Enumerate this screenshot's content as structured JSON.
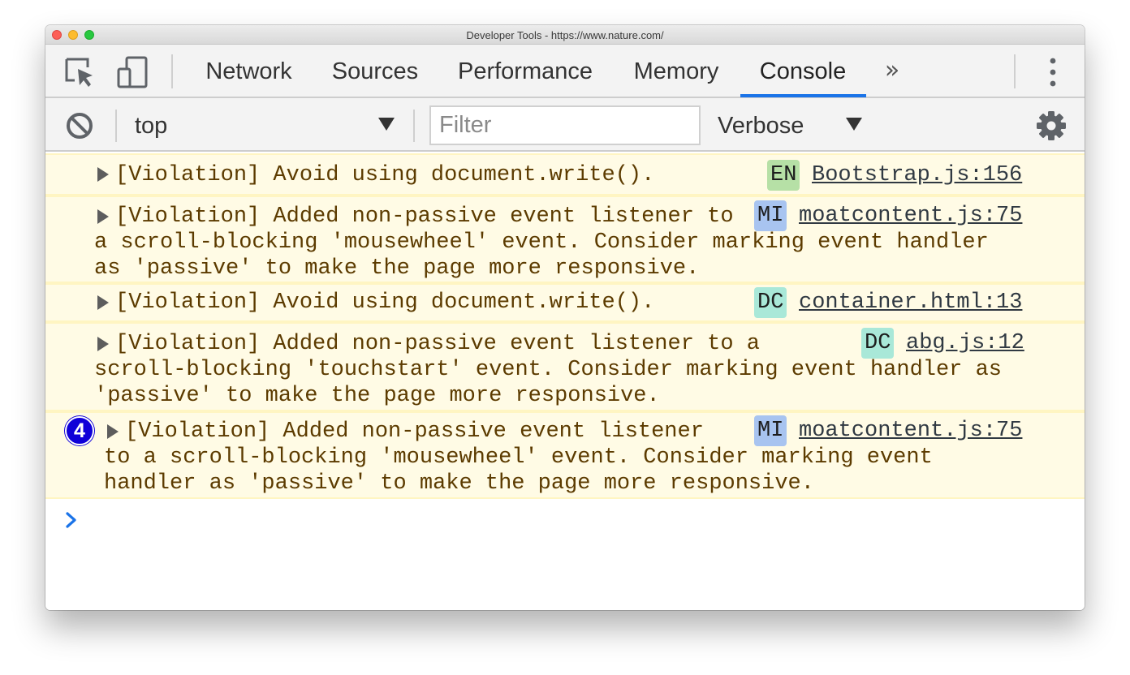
{
  "window": {
    "title": "Developer Tools - https://www.nature.com/"
  },
  "toolbar_icons": {
    "inspect": "inspect-element-icon",
    "device": "device-toolbar-icon",
    "more_tabs": "»",
    "menu": "kebab-menu-icon"
  },
  "tabs": [
    {
      "label": "Network",
      "active": false
    },
    {
      "label": "Sources",
      "active": false
    },
    {
      "label": "Performance",
      "active": false
    },
    {
      "label": "Memory",
      "active": false
    },
    {
      "label": "Console",
      "active": true
    }
  ],
  "console_toolbar": {
    "context": "top",
    "filter_placeholder": "Filter",
    "level": "Verbose",
    "accent_color": "#1a73e8"
  },
  "messages": [
    {
      "lines": [
        "[Violation] Avoid using document.write()."
      ],
      "badge": "EN",
      "badge_color": "#b6e0a6",
      "source": "Bootstrap.js:156",
      "repeat_count": null
    },
    {
      "lines": [
        "[Violation] Added non-passive event listener to",
        "a scroll-blocking 'mousewheel' event. Consider marking event handler",
        "as 'passive' to make the page more responsive."
      ],
      "badge": "MI",
      "badge_color": "#a8c4f0",
      "source": "moatcontent.js:75",
      "repeat_count": null
    },
    {
      "lines": [
        "[Violation] Avoid using document.write()."
      ],
      "badge": "DC",
      "badge_color": "#a9e8d8",
      "source": "container.html:13",
      "repeat_count": null
    },
    {
      "lines": [
        "[Violation] Added non-passive event listener to a",
        "scroll-blocking 'touchstart' event. Consider marking event handler as",
        "'passive' to make the page more responsive."
      ],
      "badge": "DC",
      "badge_color": "#a9e8d8",
      "source": "abg.js:12",
      "repeat_count": null
    },
    {
      "lines": [
        "[Violation] Added non-passive event listener",
        "to a scroll-blocking 'mousewheel' event. Consider marking event",
        "handler as 'passive' to make the page more responsive."
      ],
      "badge": "MI",
      "badge_color": "#a8c4f0",
      "source": "moatcontent.js:75",
      "repeat_count": "4"
    }
  ]
}
